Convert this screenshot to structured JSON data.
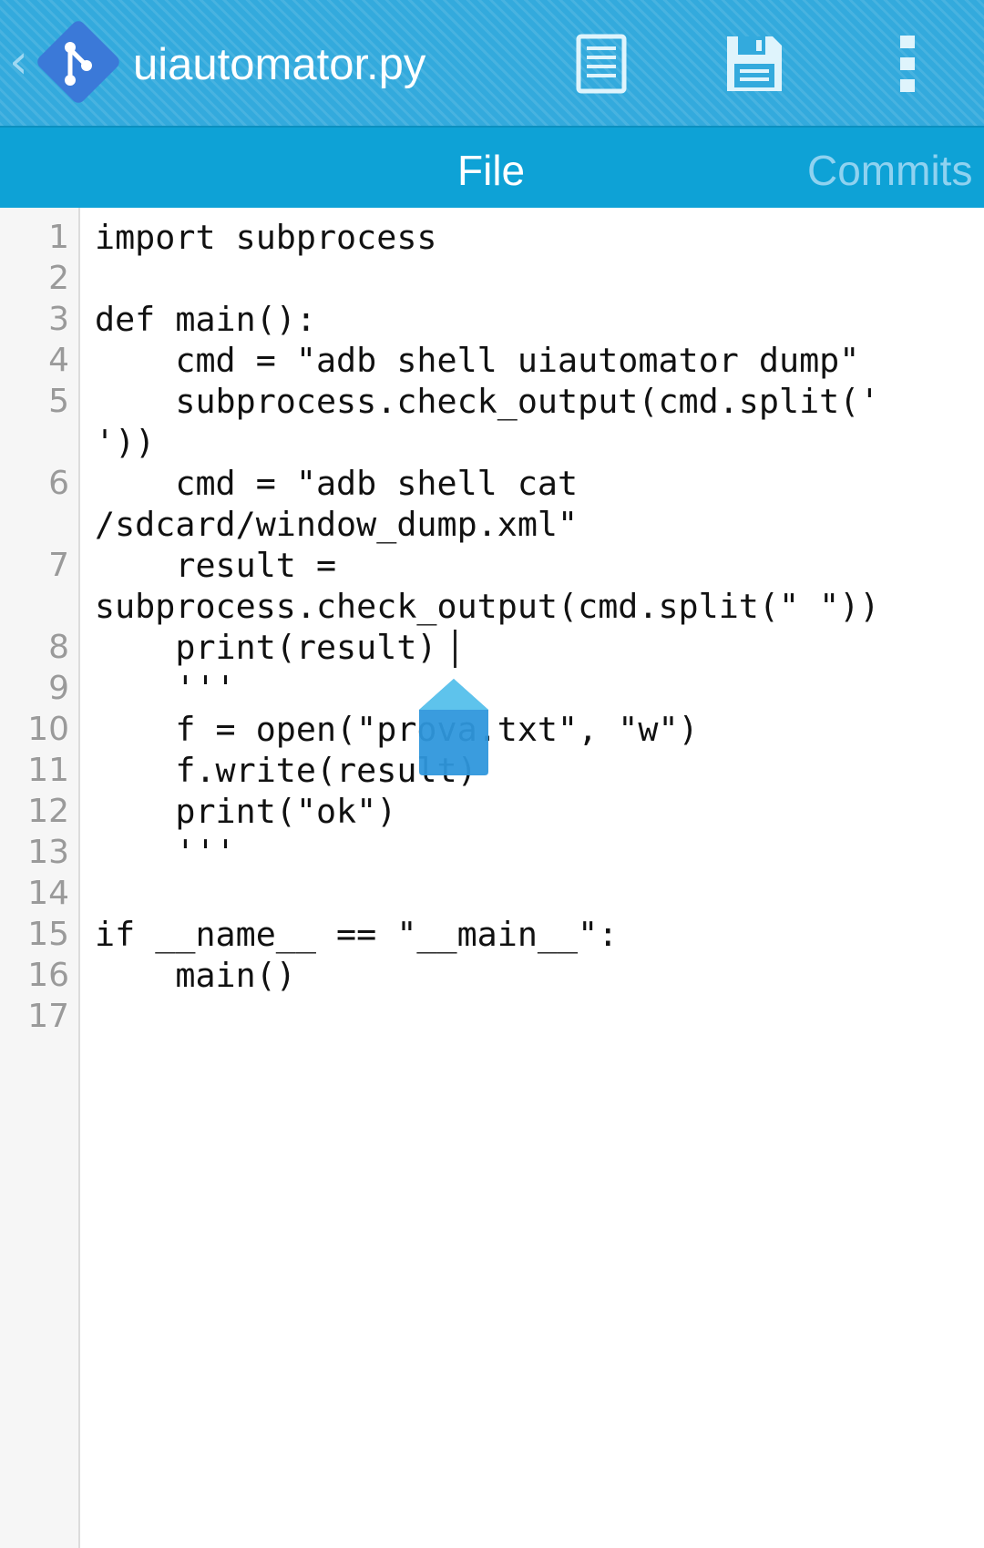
{
  "app": {
    "title": "uiautomator.py"
  },
  "toolbar": {
    "up_icon": "chevron-left-icon",
    "logo_icon": "git-logo-icon",
    "view_icon": "document-icon",
    "save_icon": "save-icon",
    "overflow_icon": "overflow-menu-icon"
  },
  "tabs": [
    {
      "label": "File",
      "selected": true
    },
    {
      "label": "Commits",
      "selected": false
    }
  ],
  "editor": {
    "line_numbers": [
      "1",
      "2",
      "3",
      "4",
      "5",
      "6",
      "7",
      "8",
      "9",
      "10",
      "11",
      "12",
      "13",
      "14",
      "15",
      "16",
      "17"
    ],
    "code": "import subprocess\n\ndef main():\n    cmd = \"adb shell uiautomator dump\"\n    subprocess.check_output(cmd.split('\n'))\n    cmd = \"adb shell cat\n/sdcard/window_dump.xml\"\n    result =\nsubprocess.check_output(cmd.split(\" \"))\n    print(result)\n    '''\n    f = open(\"prova.txt\", \"w\")\n    f.write(result)\n    print(\"ok\")\n    '''\n\nif __name__ == \"__main__\":\n    main()\n"
  },
  "colors": {
    "actionbar": "#33aadd",
    "tabbar": "#0ea2d6",
    "logo": "#3b79d8",
    "handle": "#2f97dc"
  }
}
